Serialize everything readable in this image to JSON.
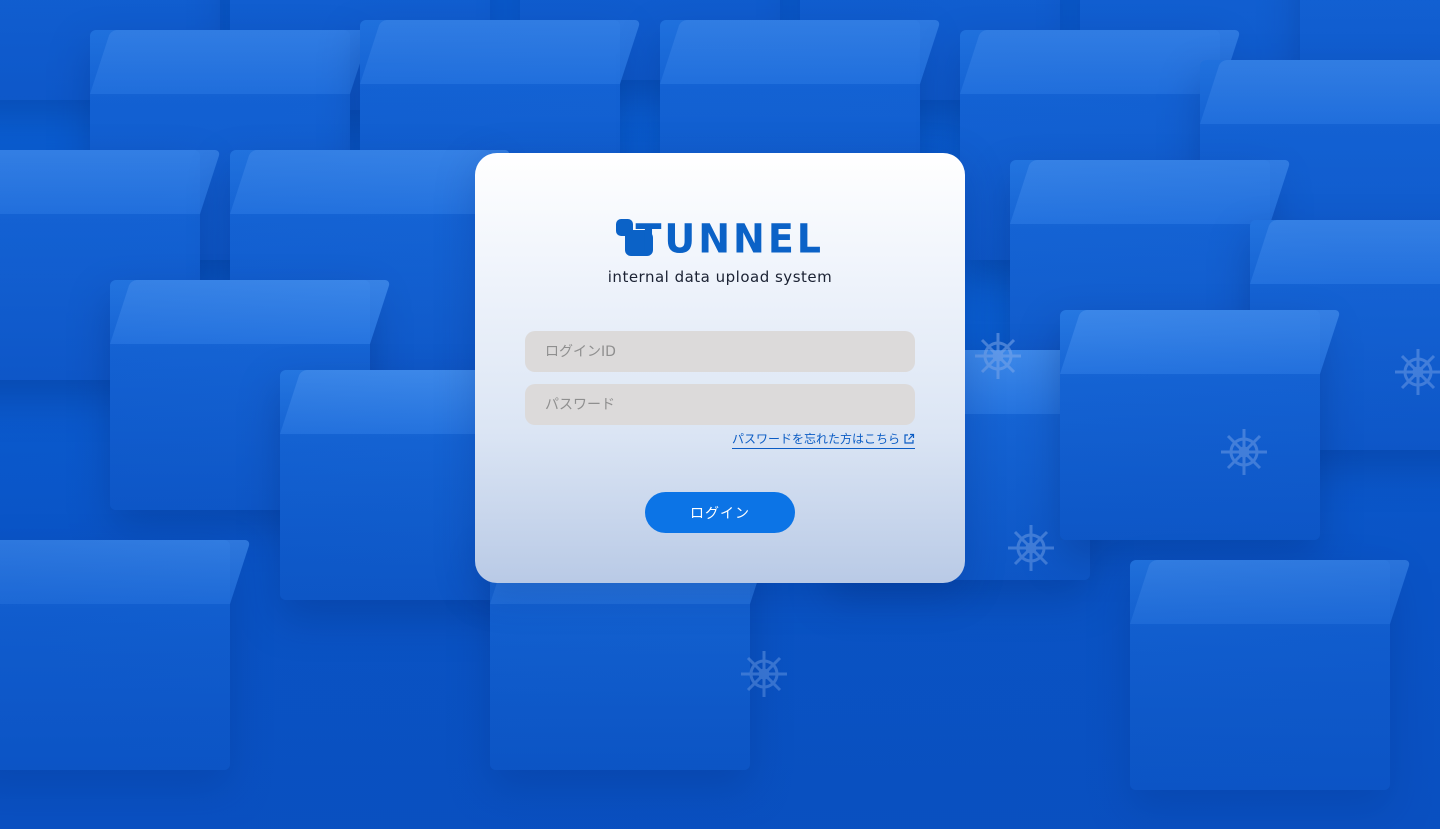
{
  "brand": {
    "name": "TUNNEL",
    "tagline": "internal data upload system",
    "color": "#0b62c7"
  },
  "login_form": {
    "login_id": {
      "value": "",
      "placeholder": "ログインID"
    },
    "password": {
      "value": "",
      "placeholder": "パスワード"
    },
    "forgot_password_link": "パスワードを忘れた方はこちら",
    "forgot_icon": "external-link-icon",
    "submit_label": "ログイン"
  },
  "colors": {
    "background": "#0a63d8",
    "button": "#0c74e6",
    "input_background": "#dcdada",
    "link": "#0b5cc4"
  },
  "background_decoration": {
    "pattern": "isometric-cubes",
    "icon": "ship-wheel-icon"
  }
}
